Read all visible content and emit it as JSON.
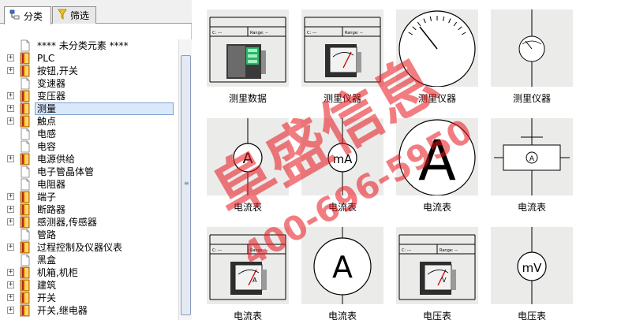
{
  "tabs": [
    {
      "label": "分类",
      "icon": "tree-icon"
    },
    {
      "label": "筛选",
      "icon": "funnel-icon"
    }
  ],
  "tree": [
    {
      "label": "**** 未分类元素 ****",
      "type": "file",
      "expandable": false
    },
    {
      "label": "PLC",
      "type": "book",
      "expandable": true
    },
    {
      "label": "按钮,开关",
      "type": "book",
      "expandable": true
    },
    {
      "label": "变速器",
      "type": "file",
      "expandable": false
    },
    {
      "label": "变压器",
      "type": "book",
      "expandable": true
    },
    {
      "label": "测量",
      "type": "book",
      "expandable": true,
      "selected": true
    },
    {
      "label": "触点",
      "type": "book",
      "expandable": true
    },
    {
      "label": "电感",
      "type": "file",
      "expandable": false
    },
    {
      "label": "电容",
      "type": "file",
      "expandable": false
    },
    {
      "label": "电源供给",
      "type": "book",
      "expandable": true
    },
    {
      "label": "电子管晶体管",
      "type": "file",
      "expandable": false
    },
    {
      "label": "电阻器",
      "type": "file",
      "expandable": false
    },
    {
      "label": "端子",
      "type": "book",
      "expandable": true
    },
    {
      "label": "断路器",
      "type": "book",
      "expandable": true
    },
    {
      "label": "感测器,传感器",
      "type": "book",
      "expandable": true
    },
    {
      "label": "管路",
      "type": "file",
      "expandable": false
    },
    {
      "label": "过程控制及仪器仪表",
      "type": "book",
      "expandable": true
    },
    {
      "label": "黑盒",
      "type": "file",
      "expandable": false
    },
    {
      "label": "机箱,机柜",
      "type": "book",
      "expandable": true
    },
    {
      "label": "建筑",
      "type": "book",
      "expandable": true
    },
    {
      "label": "开关",
      "type": "book",
      "expandable": true
    },
    {
      "label": "开关,继电器",
      "type": "book",
      "expandable": true
    }
  ],
  "symbols": [
    {
      "caption": "测里数据",
      "kind": "sheet-device",
      "meter_text": ""
    },
    {
      "caption": "测里仪器",
      "kind": "sheet-meter",
      "meter_text": ""
    },
    {
      "caption": "测里仪器",
      "kind": "big-gauge",
      "meter_text": ""
    },
    {
      "caption": "测里仪器",
      "kind": "small-gauge",
      "meter_text": ""
    },
    {
      "caption": "电流表",
      "kind": "circle-text",
      "meter_text": "A"
    },
    {
      "caption": "电流表",
      "kind": "circle-text",
      "meter_text": "mA"
    },
    {
      "caption": "电流表",
      "kind": "big-letter",
      "meter_text": "A"
    },
    {
      "caption": "电流表",
      "kind": "box-circle",
      "meter_text": "A"
    },
    {
      "caption": "电流表",
      "kind": "sheet-meter",
      "meter_text": "A"
    },
    {
      "caption": "电流表",
      "kind": "large-circle",
      "meter_text": "A"
    },
    {
      "caption": "电压表",
      "kind": "sheet-meter",
      "meter_text": "V"
    },
    {
      "caption": "电压表",
      "kind": "circle-text",
      "meter_text": "mV"
    }
  ],
  "sheet_header": {
    "c": "C: ---",
    "range": "Range: --"
  },
  "watermark": {
    "line1": "阜盛信息",
    "line2": "400-696-5950"
  },
  "colors": {
    "accent": "#dbe8fb",
    "watermark": "#e8141c",
    "thumb_bg": "#ebebea"
  }
}
